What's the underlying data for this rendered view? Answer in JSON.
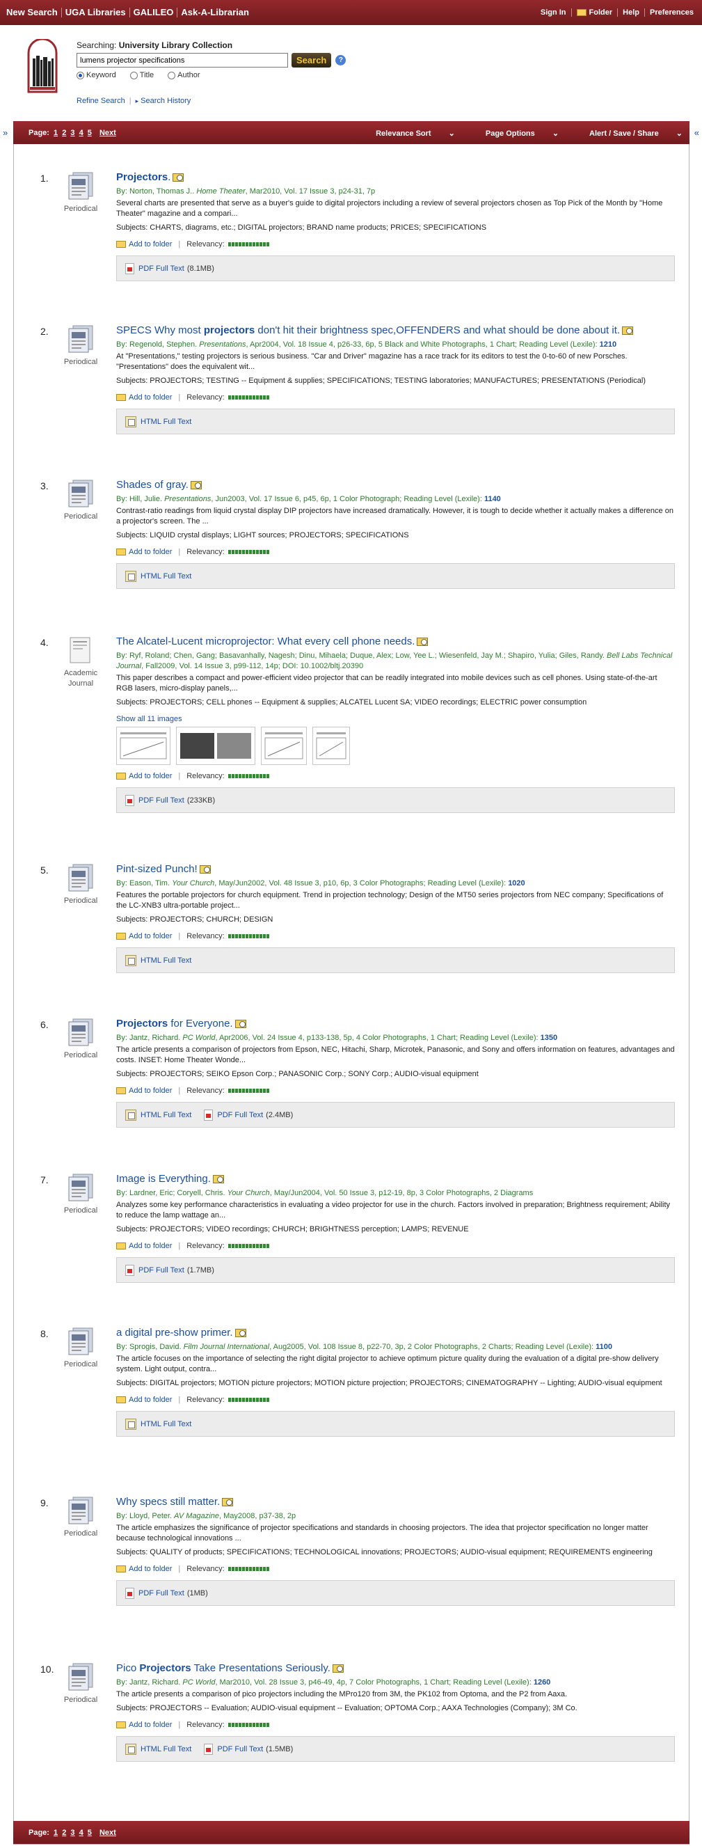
{
  "topbar": {
    "left": [
      "New Search",
      "UGA Libraries",
      "GALILEO",
      "Ask-A-Librarian"
    ],
    "right": [
      "Sign In",
      "Folder",
      "Help",
      "Preferences"
    ]
  },
  "search": {
    "searching_label": "Searching:",
    "collection": "University Library Collection",
    "query": "lumens projector specifications",
    "button": "Search",
    "help": "?",
    "options": [
      "Keyword",
      "Title",
      "Author"
    ],
    "selected": "Keyword",
    "refine": "Refine Search",
    "history": "Search History"
  },
  "pager": {
    "label": "Page:",
    "pages": [
      "1",
      "2",
      "3",
      "4",
      "5"
    ],
    "next": "Next",
    "options": [
      "Relevance Sort",
      "Page Options",
      "Alert / Save / Share"
    ]
  },
  "common": {
    "add_to_folder": "Add to folder",
    "relevancy": "Relevancy:",
    "show_all_images": "Show all 11 images"
  },
  "results": [
    {
      "num": "1.",
      "type": "Periodical",
      "title": [
        "",
        "Projectors",
        "."
      ],
      "byline": "By: Norton, Thomas J.. <i>Home Theater</i>, Mar2010, Vol. 17 Issue 3, p24-31, 7p",
      "abstract": "Several charts are presented that serve as a buyer's guide to digital projectors including a review of several projectors chosen as Top Pick of the Month by \"Home Theater\" magazine and a compari...",
      "subjects": "Subjects: CHARTS, diagrams, etc.; DIGITAL projectors; BRAND name products; PRICES; SPECIFICATIONS",
      "fulltext": [
        {
          "type": "pdf",
          "label": "PDF Full Text",
          "size": "(8.1MB)"
        }
      ]
    },
    {
      "num": "2.",
      "type": "Periodical",
      "title": [
        "SPECS Why most ",
        "projectors",
        " don't hit their brightness spec,OFFENDERS and what should be done about it."
      ],
      "byline": "By: Regenold, Stephen. <i>Presentations</i>, Apr2004, Vol. 18 Issue 4, p26-33, 6p, 5 Black and White Photographs, 1 Chart; Reading Level (Lexile): <b>1210</b>",
      "abstract": "At \"Presentations,\" testing projectors is serious business. \"Car and Driver\" magazine has a race track for its editors to test the 0-to-60 of new Porsches. \"Presentations\" does the equivalent wit...",
      "subjects": "Subjects: PROJECTORS; TESTING -- Equipment & supplies; SPECIFICATIONS; TESTING laboratories; MANUFACTURES; PRESENTATIONS (Periodical)",
      "fulltext": [
        {
          "type": "html",
          "label": "HTML Full Text",
          "size": ""
        }
      ]
    },
    {
      "num": "3.",
      "type": "Periodical",
      "title": [
        "Shades of gray.",
        "",
        ""
      ],
      "byline": "By: Hill, Julie. <i>Presentations</i>, Jun2003, Vol. 17 Issue 6, p45, 6p, 1 Color Photograph; Reading Level (Lexile): <b>1140</b>",
      "abstract": "Contrast-ratio readings from liquid crystal display DIP projectors have increased dramatically. However, it is tough to decide whether it actually makes a difference on a projector's screen. The ...",
      "subjects": "Subjects: LIQUID crystal displays; LIGHT sources; PROJECTORS; SPECIFICATIONS",
      "fulltext": [
        {
          "type": "html",
          "label": "HTML Full Text",
          "size": ""
        }
      ]
    },
    {
      "num": "4.",
      "type": "Academic Journal",
      "title": [
        "The Alcatel-Lucent microprojector: What every cell phone needs.",
        "",
        ""
      ],
      "byline": "By: Ryf, Roland; Chen, Gang; Basavanhally, Nagesh; Dinu, Mihaela; Duque, Alex; Low, Yee L.; Wiesenfeld, Jay M.; Shapiro, Yulia; Giles, Randy. <i>Bell Labs Technical Journal</i>, Fall2009, Vol. 14 Issue 3, p99-112, 14p; DOI: 10.1002/bltj.20390",
      "abstract": "This paper describes a compact and power-efficient video projector that can be readily integrated into mobile devices such as cell phones. Using state-of-the-art RGB lasers, micro-display panels,...",
      "subjects": "Subjects: PROJECTORS; CELL phones -- Equipment & supplies; ALCATEL Lucent SA; VIDEO recordings; ELECTRIC power consumption",
      "fulltext": [
        {
          "type": "pdf",
          "label": "PDF Full Text",
          "size": "(233KB)"
        }
      ]
    },
    {
      "num": "5.",
      "type": "Periodical",
      "title": [
        "Pint-sized Punch!",
        "",
        ""
      ],
      "byline": "By: Eason, Tim. <i>Your Church</i>, May/Jun2002, Vol. 48 Issue 3, p10, 6p, 3 Color Photographs; Reading Level (Lexile): <b>1020</b>",
      "abstract": "Features the portable projectors for church equipment. Trend in projection technology; Design of the MT50 series projectors from NEC company; Specifications of the LC-XNB3 ultra-portable project...",
      "subjects": "Subjects: PROJECTORS; CHURCH; DESIGN",
      "fulltext": [
        {
          "type": "html",
          "label": "HTML Full Text",
          "size": ""
        }
      ]
    },
    {
      "num": "6.",
      "type": "Periodical",
      "title": [
        "",
        "Projectors",
        " for Everyone."
      ],
      "byline": "By: Jantz, Richard. <i>PC World</i>, Apr2006, Vol. 24 Issue 4, p133-138, 5p, 4 Color Photographs, 1 Chart; Reading Level (Lexile): <b>1350</b>",
      "abstract": "The article presents a comparison of projectors from Epson, NEC, Hitachi, Sharp, Microtek, Panasonic, and Sony and offers information on features, advantages and costs. INSET: Home Theater Wonde...",
      "subjects": "Subjects: PROJECTORS; SEIKO Epson Corp.; PANASONIC Corp.; SONY Corp.; AUDIO-visual equipment",
      "fulltext": [
        {
          "type": "html",
          "label": "HTML Full Text",
          "size": ""
        },
        {
          "type": "pdf",
          "label": "PDF Full Text",
          "size": "(2.4MB)"
        }
      ]
    },
    {
      "num": "7.",
      "type": "Periodical",
      "title": [
        "Image is Everything.",
        "",
        ""
      ],
      "byline": "By: Lardner, Eric; Coryell, Chris. <i>Your Church</i>, May/Jun2004, Vol. 50 Issue 3, p12-19, 8p, 3 Color Photographs, 2 Diagrams",
      "abstract": "Analyzes some key performance characteristics in evaluating a video projector for use in the church. Factors involved in preparation; Brightness requirement; Ability to reduce the lamp wattage an...",
      "subjects": "Subjects: PROJECTORS; VIDEO recordings; CHURCH; BRIGHTNESS perception; LAMPS; REVENUE",
      "fulltext": [
        {
          "type": "pdf",
          "label": "PDF Full Text",
          "size": "(1.7MB)"
        }
      ]
    },
    {
      "num": "8.",
      "type": "Periodical",
      "title": [
        "a digital pre-show primer.",
        "",
        ""
      ],
      "byline": "By: Sprogis, David. <i>Film Journal International</i>, Aug2005, Vol. 108 Issue 8, p22-70, 3p, 2 Color Photographs, 2 Charts; Reading Level (Lexile): <b>1100</b>",
      "abstract": "The article focuses on the importance of selecting the right digital projector to achieve optimum picture quality during the evaluation of a digital pre-show delivery system. Light output, contra...",
      "subjects": "Subjects: DIGITAL projectors; MOTION picture projectors; MOTION picture projection; PROJECTORS; CINEMATOGRAPHY -- Lighting; AUDIO-visual equipment",
      "fulltext": [
        {
          "type": "html",
          "label": "HTML Full Text",
          "size": ""
        }
      ]
    },
    {
      "num": "9.",
      "type": "Periodical",
      "title": [
        "Why specs still matter.",
        "",
        ""
      ],
      "byline": "By: Lloyd, Peter. <i>AV Magazine</i>, May2008, p37-38, 2p",
      "abstract": "The article emphasizes the significance of projector specifications and standards in choosing projectors. The idea that projector specification no longer matter because technological innovations ...",
      "subjects": "Subjects: QUALITY of products; SPECIFICATIONS; TECHNOLOGICAL innovations; PROJECTORS; AUDIO-visual equipment; REQUIREMENTS engineering",
      "fulltext": [
        {
          "type": "pdf",
          "label": "PDF Full Text",
          "size": "(1MB)"
        }
      ]
    },
    {
      "num": "10.",
      "type": "Periodical",
      "title": [
        "Pico ",
        "Projectors",
        " Take Presentations Seriously."
      ],
      "byline": "By: Jantz, Richard. <i>PC World</i>, Mar2010, Vol. 28 Issue 3, p46-49, 4p, 7 Color Photographs, 1 Chart; Reading Level (Lexile): <b>1260</b>",
      "abstract": "The article presents a comparison of pico projectors including the MPro120 from 3M, the PK102 from Optoma, and the P2 from Aaxa.",
      "subjects": "Subjects: PROJECTORS -- Evaluation; AUDIO-visual equipment -- Evaluation; OPTOMA Corp.; AAXA Technologies (Company); 3M Co.",
      "fulltext": [
        {
          "type": "html",
          "label": "HTML Full Text",
          "size": ""
        },
        {
          "type": "pdf",
          "label": "PDF Full Text",
          "size": "(1.5MB)"
        }
      ]
    }
  ],
  "colors": {
    "brand": "#8b2226",
    "link": "#1a4fa0",
    "byline": "#2c7d2c"
  }
}
